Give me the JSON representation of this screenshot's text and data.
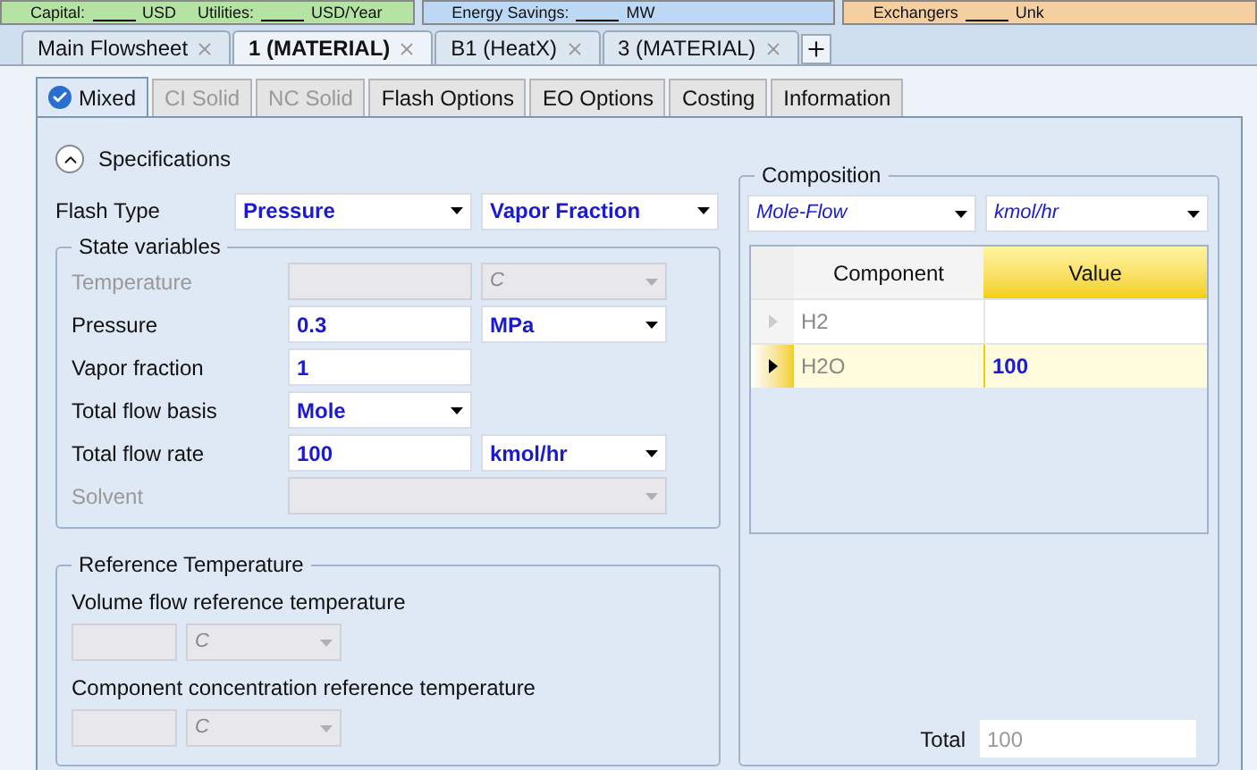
{
  "top_bar": [
    {
      "color": "#b5e3a3",
      "items": [
        {
          "label": "Capital:",
          "unit": "USD"
        },
        {
          "label": "Utilities:",
          "unit": "USD/Year"
        }
      ]
    },
    {
      "color": "#bcd8f5",
      "items": [
        {
          "label": "Energy Savings:",
          "unit": "MW"
        }
      ]
    },
    {
      "color": "#f5cfa0",
      "items": [
        {
          "label": "Exchangers",
          "unit": "Unk"
        }
      ]
    }
  ],
  "document_tabs": [
    {
      "label": "Main Flowsheet",
      "selected": false
    },
    {
      "label": "1 (MATERIAL)",
      "selected": true
    },
    {
      "label": "B1 (HeatX)",
      "selected": false
    },
    {
      "label": "3 (MATERIAL)",
      "selected": false
    }
  ],
  "form_tabs": [
    {
      "label": "Mixed",
      "selected": true,
      "disabled": false,
      "complete": true
    },
    {
      "label": "CI Solid",
      "selected": false,
      "disabled": true,
      "complete": false
    },
    {
      "label": "NC Solid",
      "selected": false,
      "disabled": true,
      "complete": false
    },
    {
      "label": "Flash Options",
      "selected": false,
      "disabled": false,
      "complete": false
    },
    {
      "label": "EO Options",
      "selected": false,
      "disabled": false,
      "complete": false
    },
    {
      "label": "Costing",
      "selected": false,
      "disabled": false,
      "complete": false
    },
    {
      "label": "Information",
      "selected": false,
      "disabled": false,
      "complete": false
    }
  ],
  "specifications": {
    "title": "Specifications",
    "expanded": true
  },
  "flash_type": {
    "label": "Flash Type",
    "first": "Pressure",
    "second": "Vapor Fraction"
  },
  "state_variables": {
    "title": "State variables",
    "rows": [
      {
        "kind": "field",
        "label": "Temperature",
        "disabled": true,
        "unit": "C"
      },
      {
        "kind": "field",
        "label": "Pressure",
        "disabled": false,
        "value": "0.3",
        "unit": "MPa"
      },
      {
        "kind": "field",
        "label": "Vapor fraction",
        "disabled": false,
        "value": "1"
      },
      {
        "kind": "select",
        "label": "Total flow basis",
        "disabled": false,
        "value": "Mole"
      },
      {
        "kind": "field",
        "label": "Total flow rate",
        "disabled": false,
        "value": "100",
        "unit": "kmol/hr"
      },
      {
        "kind": "wide_select",
        "label": "Solvent",
        "disabled": true
      }
    ]
  },
  "reference_temperature": {
    "title": "Reference Temperature",
    "items": [
      {
        "label": "Volume flow reference temperature",
        "unit": "C",
        "disabled": true
      },
      {
        "label": "Component concentration reference temperature",
        "unit": "C",
        "disabled": true
      }
    ]
  },
  "composition": {
    "title": "Composition",
    "basis": "Mole-Flow",
    "units": "kmol/hr",
    "columns": [
      "Component",
      "Value"
    ],
    "rows": [
      {
        "component": "H2",
        "selected": false
      },
      {
        "component": "H2O",
        "value": "100",
        "selected": true
      }
    ],
    "total_label": "Total",
    "total": "100"
  }
}
